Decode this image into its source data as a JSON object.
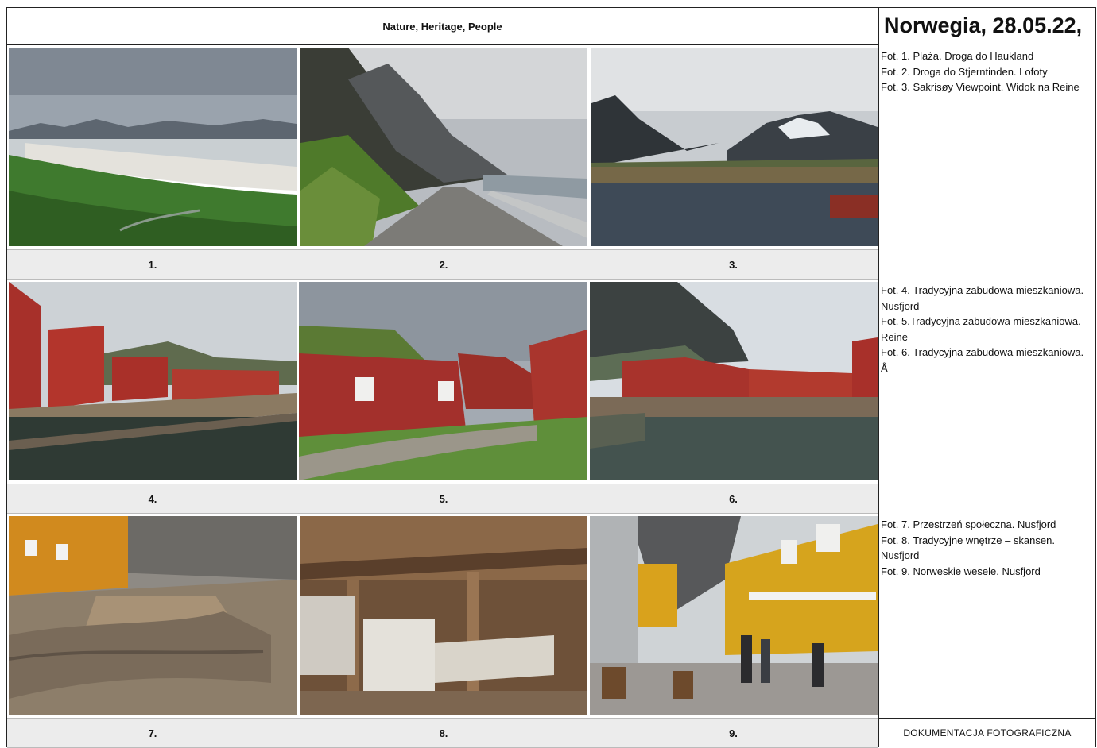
{
  "header": {
    "subtitle": "Nature, Heritage, People"
  },
  "sidebar": {
    "title": "Norwegia, 28.05.22,"
  },
  "photos": [
    {
      "number": "1."
    },
    {
      "number": "2."
    },
    {
      "number": "3."
    },
    {
      "number": "4."
    },
    {
      "number": "5."
    },
    {
      "number": "6."
    },
    {
      "number": "7."
    },
    {
      "number": "8."
    },
    {
      "number": "9."
    }
  ],
  "captions": {
    "group1": [
      "Fot. 1. Plaża. Droga do Haukland",
      "Fot. 2. Droga do Stjerntinden. Lofoty",
      "Fot. 3. Sakrisøy Viewpoint. Widok na Reine"
    ],
    "group2": [
      "Fot. 4. Tradycyjna zabudowa mieszkaniowa. Nusfjord",
      "Fot. 5.Tradycyjna zabudowa mieszkaniowa. Reine",
      "Fot. 6. Tradycyjna zabudowa mieszkaniowa. Å"
    ],
    "group3": [
      "Fot. 7. Przestrzeń społeczna. Nusfjord",
      "Fot. 8. Tradycyjne wnętrze – skansen. Nusfjord",
      "Fot. 9. Norweskie wesele. Nusfjord"
    ]
  },
  "footer": {
    "label": "DOKUMENTACJA FOTOGRAFICZNA"
  }
}
